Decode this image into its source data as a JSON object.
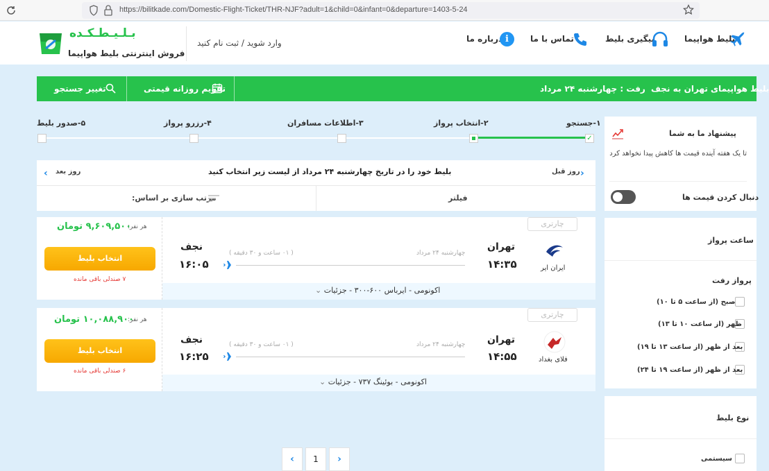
{
  "browser": {
    "url": "https://bilitkade.com/Domestic-Flight-Ticket/THR-NJF?adult=1&child=0&infant=0&departure=1403-5-24"
  },
  "header": {
    "logo_text": "بـلـيـطـكـده",
    "logo_tagline": "فروش اینترنتی بلیط هواپیما",
    "login": "وارد شوید / ثبت نام کنید",
    "nav": [
      "بلیط هواپیما",
      "پیگیری بلیط",
      "تماس با ما",
      "درباره ما"
    ]
  },
  "route_bar": {
    "title": "بلیط هواپیمای تهران به نجف",
    "date": "رفت : چهارشنبه ۲۴ مرداد",
    "calendar_button": "تقویم روزانه قیمتی",
    "change_button": "تغییر جستجو"
  },
  "steps": [
    "۱-جستجو",
    "۲-انتخاب پرواز",
    "۳-اطلاعات مسافران",
    "۴-رزرو پرواز",
    "۵-صدور بلیط"
  ],
  "day_nav": {
    "prev": "روز قبل",
    "next": "روز بعد",
    "message": "بلیط خود را در تاریخ چهارشنبه ۲۴ مرداد از لیست زیر انتخاب کنید",
    "filter": "فیلتر",
    "sort": "مرتب سازی بر اساس:"
  },
  "flights": [
    {
      "airline": "ایران ایر",
      "tag": "چارتری",
      "origin": "تهران",
      "dep_time": "۱۴:۳۵",
      "dep_date": "چهارشنبه ۲۴ مرداد",
      "dest": "نجف",
      "arr_time": "۱۶:۰۵",
      "duration": "( ۰۱ ساعت و ۳۰ دقیقه )",
      "per_person": "هر نفر:",
      "price": "۹,۶۰۹,۵۰۰ تومان",
      "select": "انتخاب بلیط",
      "seats": "۷ صندلی باقی مانده",
      "details": "اکونومی - ایرباس ۶۰۰-۳۰۰ - جزئیات"
    },
    {
      "airline": "فلای بغداد",
      "tag": "چارتری",
      "origin": "تهران",
      "dep_time": "۱۴:۵۵",
      "dep_date": "چهارشنبه ۲۴ مرداد",
      "dest": "نجف",
      "arr_time": "۱۶:۲۵",
      "duration": "( ۰۱ ساعت و ۳۰ دقیقه )",
      "per_person": "هر نفر:",
      "price": "۱۰,۰۸۸,۹۰۰ تومان",
      "select": "انتخاب بلیط",
      "seats": "۶ صندلی باقی مانده",
      "details": "اکونومی - بوئینگ ۷۳۷ - جزئیات"
    }
  ],
  "pagination": {
    "page": "1"
  },
  "sidebar": {
    "suggest_title": "پیشنهاد ما به شما",
    "suggest_text": "تا یک هفته آینده قیمت ها کاهش پیدا نخواهد کرد",
    "follow_price": "دنبال کردن قیمت ها",
    "flight_time": "ساعت پرواز",
    "depart_heading": "پرواز رفت",
    "time_options": [
      "صبح (از ساعت ۵ تا ۱۰)",
      "ظهر (از ساعت ۱۰ تا ۱۳)",
      "بعد از ظهر (از ساعت ۱۳ تا ۱۹)",
      "بعد از ظهر (از ساعت ۱۹ تا ۲۴)"
    ],
    "ticket_type": "نوع بلیط",
    "ticket_options": [
      "سیستمی"
    ]
  },
  "colors": {
    "green": "#27c24c",
    "orange": "#f7a800",
    "blue": "#1e88e5",
    "bg": "#ddeefa"
  }
}
